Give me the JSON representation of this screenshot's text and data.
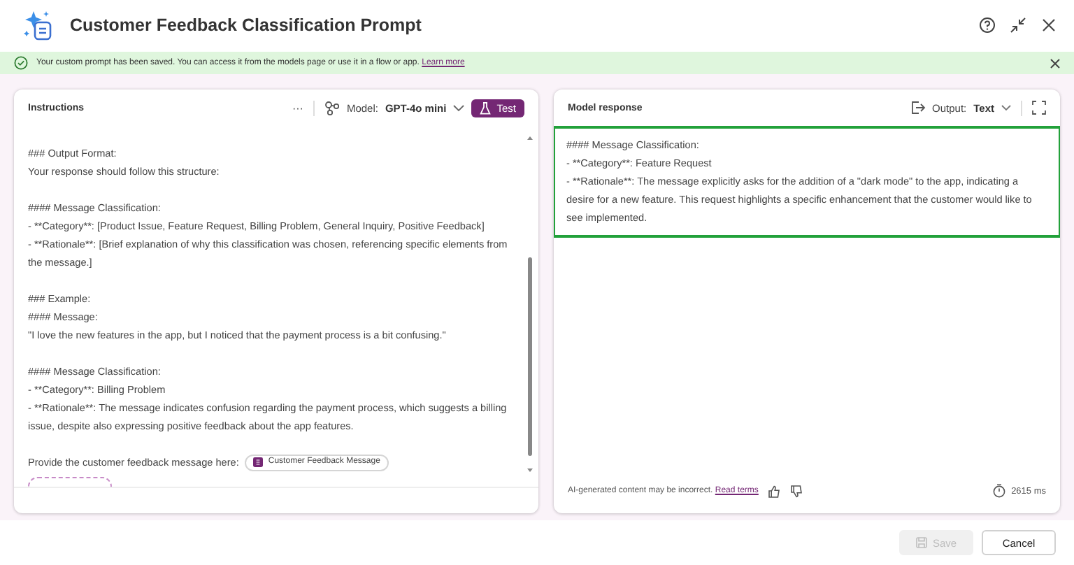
{
  "header": {
    "title": "Customer Feedback Classification Prompt"
  },
  "banner": {
    "message": "Your custom prompt has been saved. You can access it from the models page or use it in a flow or app.",
    "link": "Learn more"
  },
  "instructions": {
    "title": "Instructions",
    "more": "···",
    "model_label": "Model:",
    "model_value": "GPT-4o mini",
    "test_button": "Test",
    "blocks": [
      [
        "### Output Format:",
        "Your response should follow this structure:"
      ],
      [
        "#### Message Classification:",
        "- **Category**: [Product Issue, Feature Request, Billing Problem, General Inquiry, Positive Feedback]",
        "- **Rationale**: [Brief explanation of why this classification was chosen, referencing specific elements from the message.]"
      ],
      [
        "### Example:",
        "#### Message:",
        "\"I love the new features in the app, but I noticed that the payment process is a bit confusing.\""
      ],
      [
        "#### Message Classification:",
        "- **Category**: Billing Problem",
        "- **Rationale**: The message indicates confusion regarding the payment process, which suggests a billing issue, despite also expressing positive feedback about the app features."
      ]
    ],
    "prompt_label": "Provide the customer feedback message here:",
    "input_chip": "Customer Feedback Message"
  },
  "response": {
    "title": "Model response",
    "output_label": "Output:",
    "output_value": "Text",
    "lines": [
      "#### Message Classification:",
      "- **Category**: Feature Request",
      "- **Rationale**: The message explicitly asks for the addition of a \"dark mode\" to the app, indicating a desire for a new feature. This request highlights a specific enhancement that the customer would like to see implemented."
    ],
    "disclaimer": "AI-generated content may be incorrect.",
    "terms_link": "Read terms",
    "duration": "2615 ms"
  },
  "footer": {
    "buttons": [
      {
        "kind": "save",
        "label": "Save",
        "disabled": true
      },
      {
        "kind": "cancel",
        "label": "Cancel",
        "disabled": false
      }
    ]
  }
}
